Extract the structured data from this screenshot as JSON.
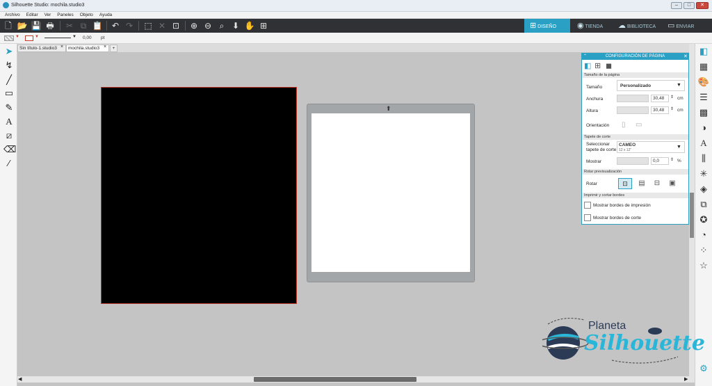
{
  "window": {
    "title": "Silhouette Studio: mochila.studio3"
  },
  "menu": [
    "Archivo",
    "Editar",
    "Ver",
    "Paneles",
    "Objeto",
    "Ayuda"
  ],
  "nav_tabs": [
    {
      "label": "DISEÑO",
      "active": true
    },
    {
      "label": "TIENDA"
    },
    {
      "label": "BIBLIOTECA"
    },
    {
      "label": "ENVIAR"
    }
  ],
  "props": {
    "line_width": "0,00",
    "unit": "pt"
  },
  "doc_tabs": [
    {
      "label": "Sin título-1.studio3",
      "close": "×"
    },
    {
      "label": "mochila.studio3",
      "close": "×",
      "active": true
    },
    {
      "label": "+"
    }
  ],
  "panel": {
    "title": "CONFIGURACIÓN DE PÁGINA",
    "sections": {
      "page_size": "Tamaño de la página",
      "cut_mat": "Tapete de corte",
      "rotate_preview": "Rotar previsualización",
      "print_cut_borders": "Imprimir y cortar bordes"
    },
    "size_label": "Tamaño",
    "size_value": "Personalizado",
    "width_label": "Anchura",
    "width_value": "30,48",
    "width_unit": "cm",
    "height_label": "Altura",
    "height_value": "30,48",
    "height_unit": "cm",
    "orientation_label": "Orientación",
    "mat_label_1": "Seleccionar",
    "mat_label_2": "tapete de corte",
    "mat_value": "CAMEO",
    "mat_sub": "12 x 12\"",
    "show_label": "Mostrar",
    "show_value": "0,0",
    "show_unit": "%",
    "rotate_label": "Rotar",
    "chk_print": "Mostrar bordes de impresión",
    "chk_cut": "Mostrar bordes de corte"
  },
  "brand": {
    "line1": "Planeta",
    "line2": "Silhouette"
  },
  "colors": {
    "accent": "#2aa0c4",
    "toolbar": "#2f3134",
    "mat_black": "#000000",
    "mat_gray": "#a3a6a9"
  }
}
